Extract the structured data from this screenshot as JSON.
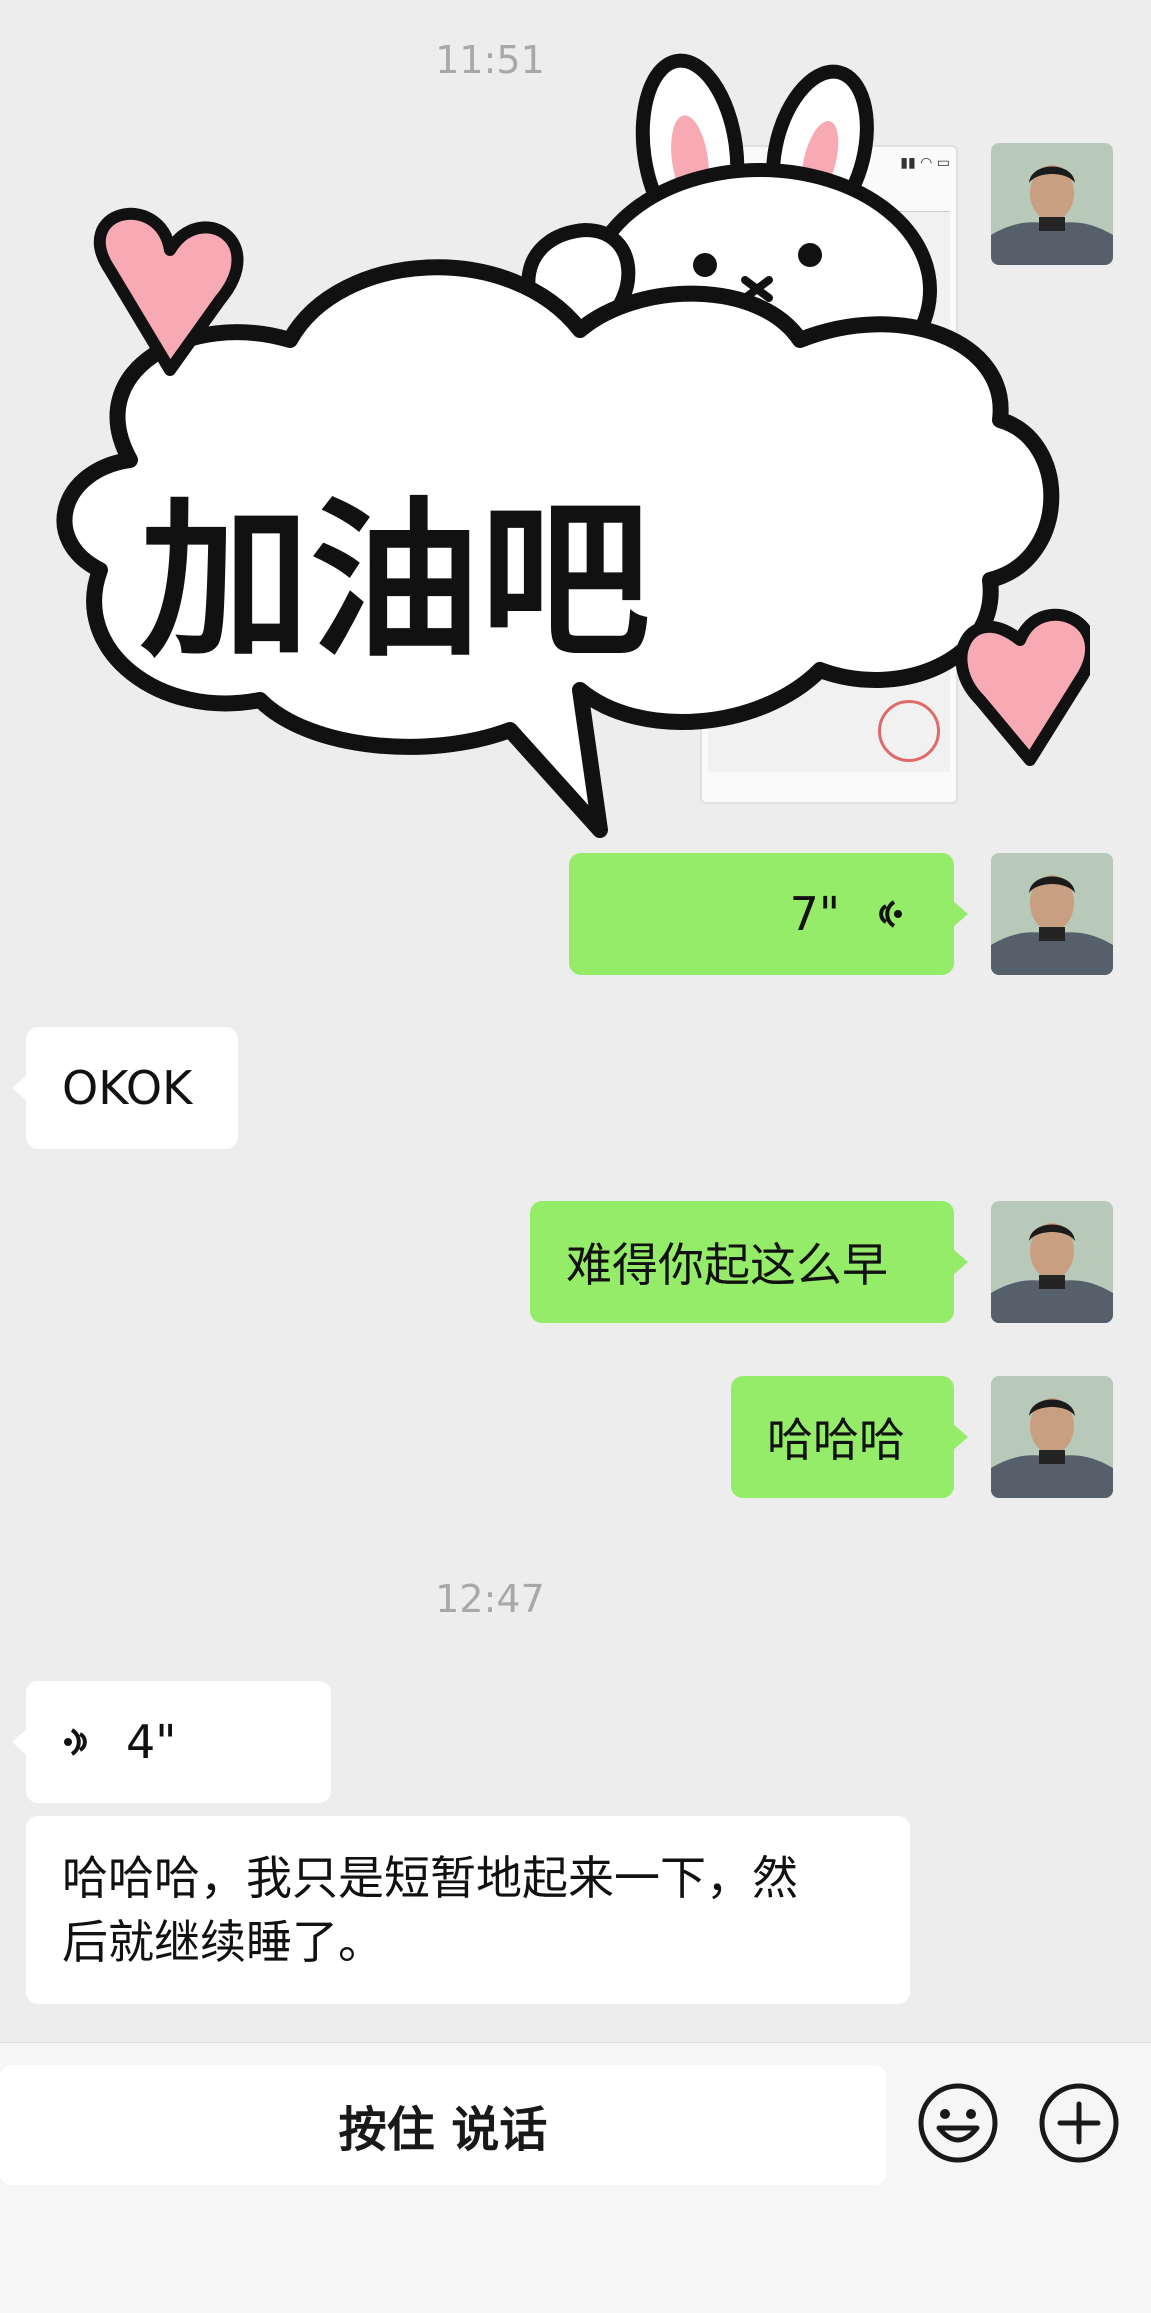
{
  "timestamps": [
    "11:51",
    "12:47"
  ],
  "sticker": {
    "text": "加油吧",
    "description": "bunny-cloud-sticker"
  },
  "messages": {
    "voice_out": {
      "duration": "7\""
    },
    "okok": "OKOK",
    "rare_early": "难得你起这么早",
    "hahaha": "哈哈哈",
    "voice_in": {
      "duration": "4\""
    },
    "reply_line1": "哈哈哈，我只是短暂地起来一下，然",
    "reply_line2": "后就继续睡了。"
  },
  "input_bar": {
    "hold_to_talk": "按住 说话"
  },
  "colors": {
    "sent_bubble": "#95ec69",
    "received_bubble": "#ffffff",
    "background": "#ededed"
  }
}
